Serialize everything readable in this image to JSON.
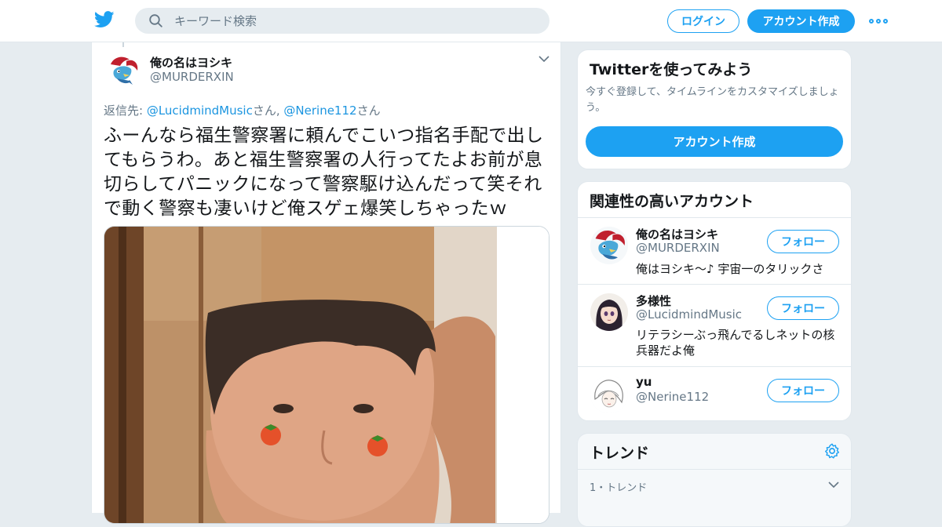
{
  "header": {
    "search_placeholder": "キーワード検索",
    "login_label": "ログイン",
    "signup_label": "アカウント作成",
    "brand_color": "#1da1f2"
  },
  "tweet": {
    "name": "俺の名はヨシキ",
    "handle": "@MURDERXIN",
    "reply_prefix": "返信先: ",
    "reply_user1": "@LucidmindMusic",
    "reply_san1": "さん, ",
    "reply_user2": "@Nerine112",
    "reply_san2": "さん",
    "text": "ふーんなら福生警察署に頼んでこいつ指名手配で出してもらうわ。あと福生警察署の人行ってたよお前が息切らしてパニックになって警察駆け込んだって笑それで動く警察も凄いけど俺スゲェ爆笑しちゃったｗ"
  },
  "signup_card": {
    "title": "Twitterを使ってみよう",
    "subtitle": "今すぐ登録して、タイムラインをカスタマイズしましょう。",
    "button_label": "アカウント作成"
  },
  "related": {
    "title": "関連性の高いアカウント",
    "follow_label": "フォロー",
    "accounts": [
      {
        "name": "俺の名はヨシキ",
        "handle": "@MURDERXIN",
        "bio": "俺はヨシキ～♪ 宇宙一のタリックさ"
      },
      {
        "name": "多様性",
        "handle": "@LucidmindMusic",
        "bio": "リテラシーぶっ飛んでるしネットの核兵器だよ俺"
      },
      {
        "name": "yu",
        "handle": "@Nerine112",
        "bio": ""
      }
    ]
  },
  "trends": {
    "title": "トレンド",
    "first_meta": "1・トレンド"
  }
}
